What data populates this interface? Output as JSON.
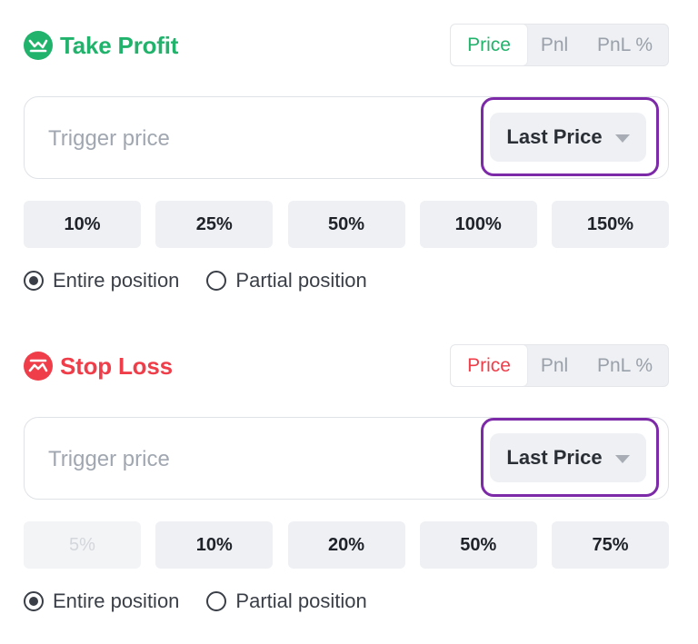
{
  "colors": {
    "take_profit": "#21b26b",
    "stop_loss": "#ef3e4a",
    "highlight": "#7d2aa8"
  },
  "take_profit": {
    "title": "Take Profit",
    "icon": "chart-trend-up-icon",
    "mode_options": [
      "Price",
      "Pnl",
      "PnL %"
    ],
    "mode_selected": "Price",
    "trigger_placeholder": "Trigger price",
    "trigger_value": "",
    "price_type": "Last Price",
    "percent_buttons": [
      "10%",
      "25%",
      "50%",
      "100%",
      "150%"
    ],
    "position_options": [
      "Entire position",
      "Partial position"
    ],
    "position_selected": "Entire position"
  },
  "stop_loss": {
    "title": "Stop Loss",
    "icon": "chart-trend-down-icon",
    "mode_options": [
      "Price",
      "Pnl",
      "PnL %"
    ],
    "mode_selected": "Price",
    "trigger_placeholder": "Trigger price",
    "trigger_value": "",
    "price_type": "Last Price",
    "percent_buttons": [
      "5%",
      "10%",
      "20%",
      "50%",
      "75%"
    ],
    "percent_disabled": [
      "5%"
    ],
    "position_options": [
      "Entire position",
      "Partial position"
    ],
    "position_selected": "Entire position"
  }
}
